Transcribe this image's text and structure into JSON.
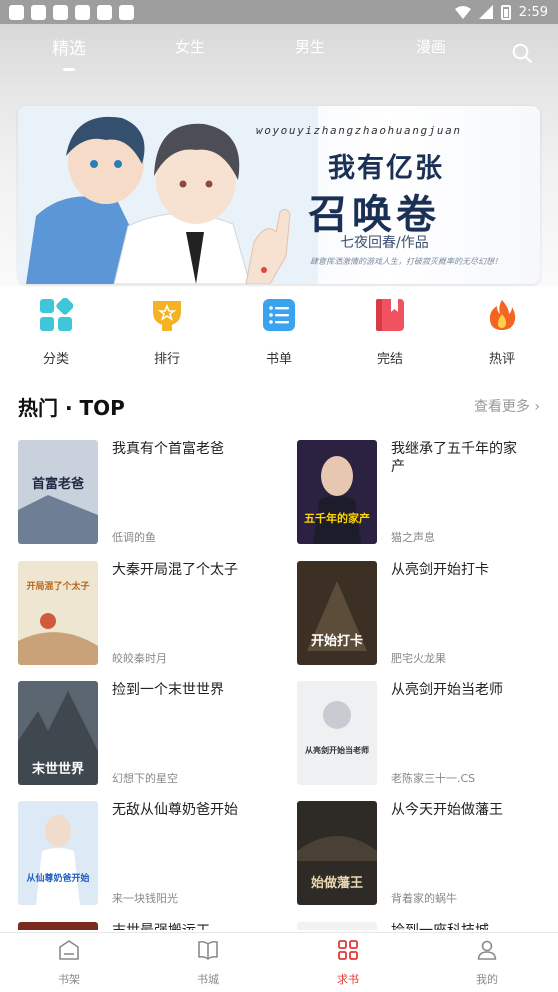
{
  "status_bar": {
    "time": "2:59"
  },
  "top_tabs": [
    {
      "label": "精选",
      "active": true
    },
    {
      "label": "女生",
      "active": false
    },
    {
      "label": "男生",
      "active": false
    },
    {
      "label": "漫画",
      "active": false
    }
  ],
  "banner": {
    "pinyin": "woyouyizhangzhaohuangjuan",
    "title_line1": "我有亿张",
    "title_line2": "召唤卷",
    "author": "七夜回春/作品",
    "tagline": "肆意挥洒激情的游戏人生，打破寂灭概率的无尽幻想！"
  },
  "categories": [
    {
      "label": "分类",
      "icon": "grid-icon",
      "color": "#3fc6d8"
    },
    {
      "label": "排行",
      "icon": "trophy-icon",
      "color": "#f5b324"
    },
    {
      "label": "书单",
      "icon": "list-icon",
      "color": "#3aa3f0"
    },
    {
      "label": "完结",
      "icon": "bookmark-book-icon",
      "color": "#f0525f"
    },
    {
      "label": "热评",
      "icon": "flame-icon",
      "color": "#f26522"
    }
  ],
  "section": {
    "title": "热门 · TOP",
    "more": "查看更多"
  },
  "books": [
    {
      "title": "我真有个首富老爸",
      "author": "低调的鱼"
    },
    {
      "title": "我继承了五千年的家产",
      "author": "猫之声息"
    },
    {
      "title": "大秦开局混了个太子",
      "author": "皎皎秦时月"
    },
    {
      "title": "从亮剑开始打卡",
      "author": "肥宅火龙果"
    },
    {
      "title": "捡到一个末世世界",
      "author": "幻想下的星空"
    },
    {
      "title": "从亮剑开始当老师",
      "author": "老陈家三十一.CS"
    },
    {
      "title": "无敌从仙尊奶爸开始",
      "author": "来一块钱阳光"
    },
    {
      "title": "从今天开始做藩王",
      "author": "背着家的蜗牛"
    },
    {
      "title": "末世最强搬运工",
      "author": ""
    },
    {
      "title": "捡到一座科技城",
      "author": ""
    }
  ],
  "covers": [
    {
      "text": "首富老爸",
      "bg": "#c9d2dc",
      "fg": "#1f2a44"
    },
    {
      "text": "五千年的家产",
      "bg": "#2b2140",
      "fg": "#ffd700"
    },
    {
      "text": "开局混了个太子",
      "bg": "#efe6d2",
      "fg": "#b5651d"
    },
    {
      "text": "开始打卡",
      "bg": "#3b3023",
      "fg": "#ffffff"
    },
    {
      "text": "末世世界",
      "bg": "#5c6670",
      "fg": "#ffffff"
    },
    {
      "text": "从亮剑开始当老师",
      "bg": "#eef0f2",
      "fg": "#333333"
    },
    {
      "text": "从仙尊奶爸开始",
      "bg": "#dde9f5",
      "fg": "#1e5fbf"
    },
    {
      "text": "始做藩王",
      "bg": "#2e2a26",
      "fg": "#e8d8b0"
    },
    {
      "text": "",
      "bg": "#7a2a1e",
      "fg": "#ffffff"
    },
    {
      "text": "",
      "bg": "#f2f2f2",
      "fg": "#333333"
    }
  ],
  "bottom_tabs": [
    {
      "label": "书架",
      "icon": "bookshelf-icon",
      "active": false
    },
    {
      "label": "书城",
      "icon": "open-book-icon",
      "active": false
    },
    {
      "label": "求书",
      "icon": "request-grid-icon",
      "active": true
    },
    {
      "label": "我的",
      "icon": "profile-icon",
      "active": false
    }
  ],
  "colors": {
    "accent": "#e53935",
    "inactive": "#8a8a8a"
  }
}
